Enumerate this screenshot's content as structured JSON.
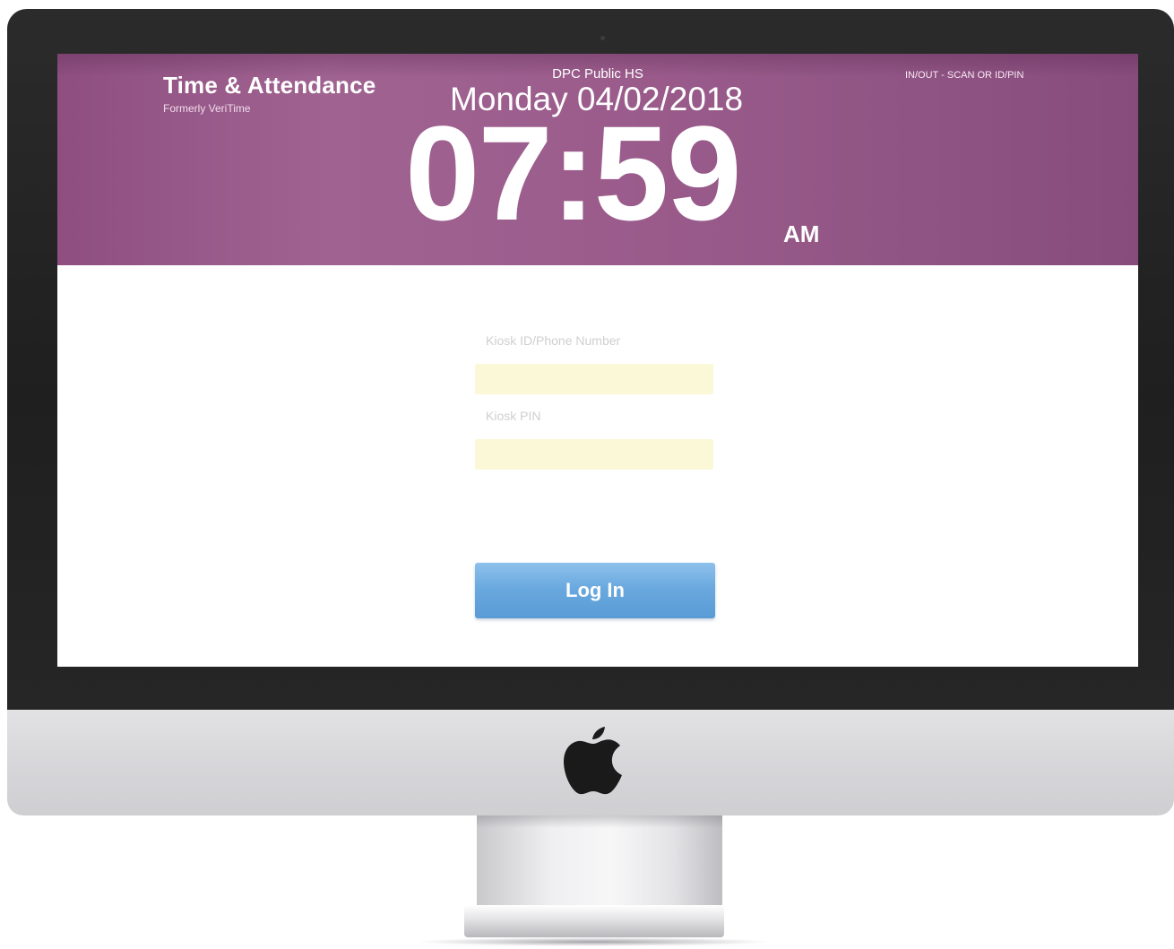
{
  "app": {
    "title": "Time & Attendance",
    "subtitle": "Formerly VeriTime"
  },
  "header": {
    "site_name": "DPC Public HS",
    "mode_label": "IN/OUT - SCAN OR ID/PIN",
    "date": "Monday 04/02/2018",
    "time": "07:59",
    "ampm": "AM",
    "accent_color": "#9a5b8b"
  },
  "login": {
    "kiosk_id_label": "Kiosk ID/Phone Number",
    "kiosk_id_value": "",
    "kiosk_pin_label": "Kiosk PIN",
    "kiosk_pin_value": "",
    "submit_label": "Log In",
    "button_color": "#6aa9df",
    "field_color": "#fbf8d8"
  },
  "device": {
    "logo_icon": "apple-logo-icon"
  }
}
